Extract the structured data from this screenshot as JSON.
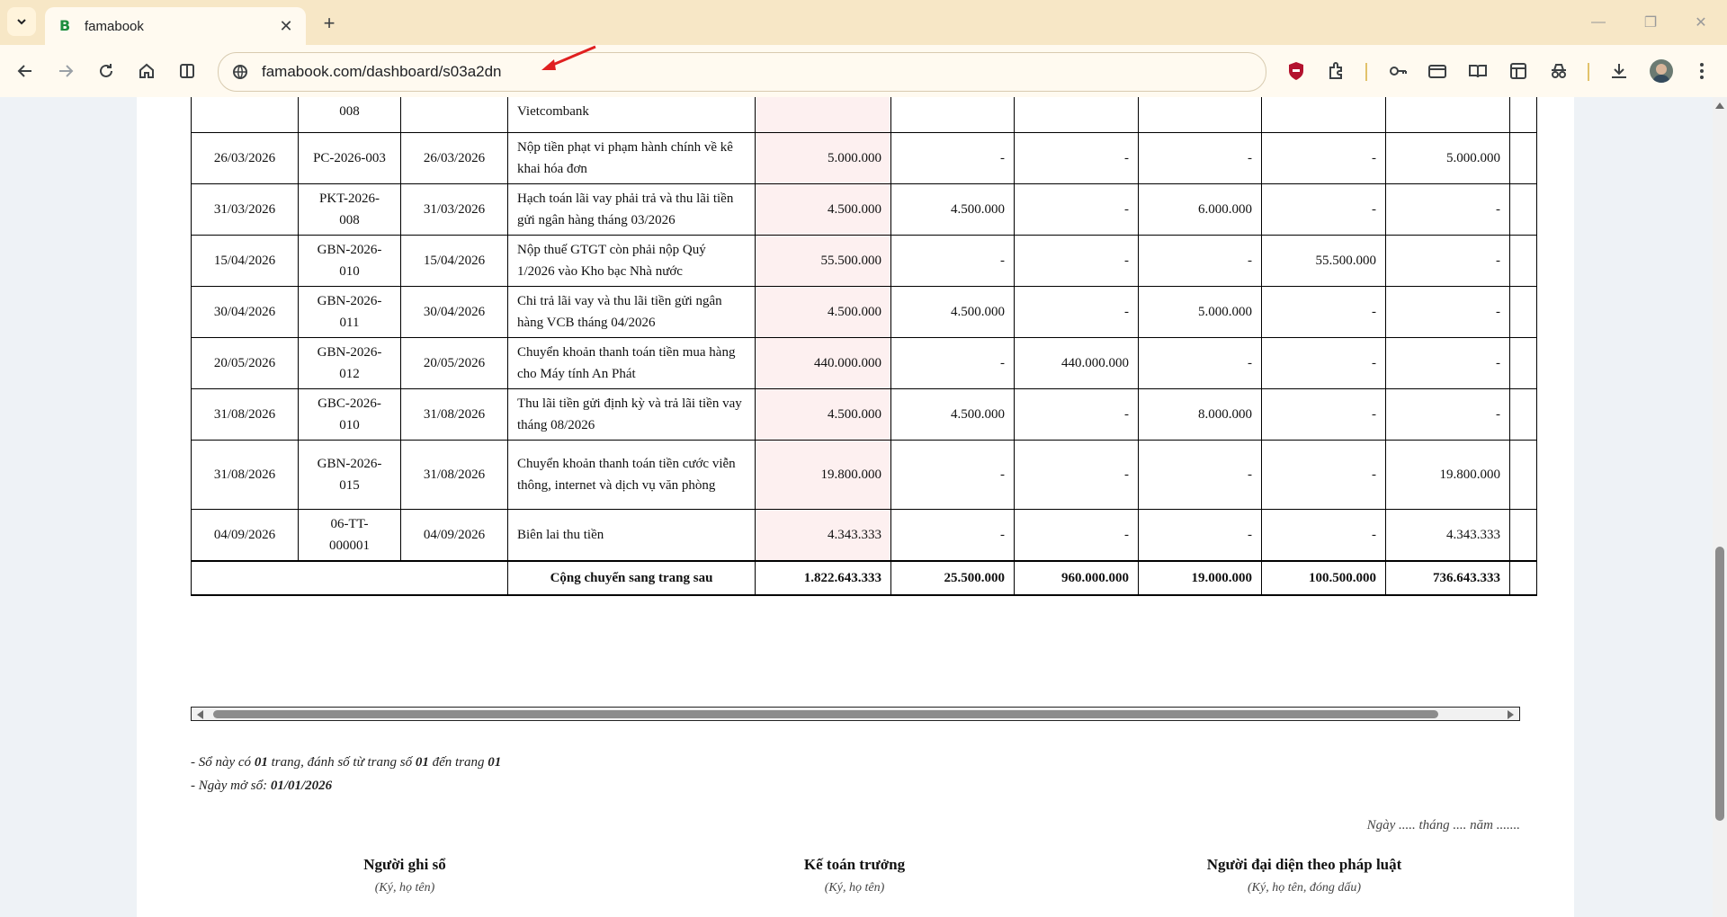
{
  "browser": {
    "tab_title": "famabook",
    "tab_favicon": "B",
    "url": "famabook.com/dashboard/s03a2dn"
  },
  "icons": [
    "chevron-down-icon",
    "close-icon",
    "plus-icon",
    "minimize-icon",
    "restore-icon",
    "window-close-icon",
    "back-icon",
    "forward-icon",
    "reload-icon",
    "home-icon",
    "split-view-icon",
    "site-info-icon",
    "shield-extension-icon",
    "extensions-icon",
    "key-icon",
    "card-icon",
    "reading-mode-icon",
    "sidebar-icon",
    "incognito-icon",
    "download-icon",
    "more-vert-icon"
  ],
  "ledger": {
    "rows": [
      {
        "date": "",
        "doc_no": "008",
        "doc_date": "",
        "desc": "Vietcombank",
        "c1": "",
        "c2": "",
        "c3": "",
        "c4": "",
        "c5": "",
        "c6": ""
      },
      {
        "date": "26/03/2026",
        "doc_no": "PC-2026-003",
        "doc_date": "26/03/2026",
        "desc": "Nộp tiền phạt vi phạm hành chính về kê khai hóa đơn",
        "c1": "5.000.000",
        "c2": "-",
        "c3": "-",
        "c4": "-",
        "c5": "-",
        "c6": "5.000.000"
      },
      {
        "date": "31/03/2026",
        "doc_no": "PKT-2026-008",
        "doc_date": "31/03/2026",
        "desc": "Hạch toán lãi vay phải trả và thu lãi tiền gửi ngân hàng tháng 03/2026",
        "c1": "4.500.000",
        "c2": "4.500.000",
        "c3": "-",
        "c4": "6.000.000",
        "c5": "-",
        "c6": "-"
      },
      {
        "date": "15/04/2026",
        "doc_no": "GBN-2026-010",
        "doc_date": "15/04/2026",
        "desc": "Nộp thuế GTGT còn phải nộp Quý 1/2026 vào Kho bạc Nhà nước",
        "c1": "55.500.000",
        "c2": "-",
        "c3": "-",
        "c4": "-",
        "c5": "55.500.000",
        "c6": "-"
      },
      {
        "date": "30/04/2026",
        "doc_no": "GBN-2026-011",
        "doc_date": "30/04/2026",
        "desc": "Chi trả lãi vay và thu lãi tiền gửi ngân hàng VCB tháng 04/2026",
        "c1": "4.500.000",
        "c2": "4.500.000",
        "c3": "-",
        "c4": "5.000.000",
        "c5": "-",
        "c6": "-"
      },
      {
        "date": "20/05/2026",
        "doc_no": "GBN-2026-012",
        "doc_date": "20/05/2026",
        "desc": "Chuyển khoản thanh toán tiền mua hàng cho Máy tính An Phát",
        "c1": "440.000.000",
        "c2": "-",
        "c3": "440.000.000",
        "c4": "-",
        "c5": "-",
        "c6": "-"
      },
      {
        "date": "31/08/2026",
        "doc_no": "GBC-2026-010",
        "doc_date": "31/08/2026",
        "desc": "Thu lãi tiền gửi định kỳ và trả lãi tiền vay tháng 08/2026",
        "c1": "4.500.000",
        "c2": "4.500.000",
        "c3": "-",
        "c4": "8.000.000",
        "c5": "-",
        "c6": "-"
      },
      {
        "date": "31/08/2026",
        "doc_no": "GBN-2026-015",
        "doc_date": "31/08/2026",
        "desc": "Chuyển khoản thanh toán tiền cước viễn thông, internet và dịch vụ văn phòng",
        "c1": "19.800.000",
        "c2": "-",
        "c3": "-",
        "c4": "-",
        "c5": "-",
        "c6": "19.800.000"
      },
      {
        "date": "04/09/2026",
        "doc_no": "06-TT-000001",
        "doc_date": "04/09/2026",
        "desc": "Biên lai thu tiền",
        "c1": "4.343.333",
        "c2": "-",
        "c3": "-",
        "c4": "-",
        "c5": "-",
        "c6": "4.343.333"
      }
    ],
    "total": {
      "label": "Cộng chuyển sang trang sau",
      "c1": "1.822.643.333",
      "c2": "25.500.000",
      "c3": "960.000.000",
      "c4": "19.000.000",
      "c5": "100.500.000",
      "c6": "736.643.333"
    }
  },
  "notes": {
    "pages_prefix": "- Sổ này có ",
    "pages_count": "01",
    "pages_mid": " trang, đánh số từ trang số ",
    "pages_from": "01",
    "pages_to_text": " đến trang ",
    "pages_to": "01",
    "open_date_prefix": "- Ngày mở sổ: ",
    "open_date": "01/01/2026",
    "date_line": "Ngày ..... tháng .... năm ......."
  },
  "signatures": [
    {
      "title": "Người ghi sổ",
      "sub": "(Ký, họ tên)"
    },
    {
      "title": "Kế toán trưởng",
      "sub": "(Ký, họ tên)"
    },
    {
      "title": "Người đại diện theo pháp luật",
      "sub": "(Ký, họ tên, đóng dấu)"
    }
  ]
}
